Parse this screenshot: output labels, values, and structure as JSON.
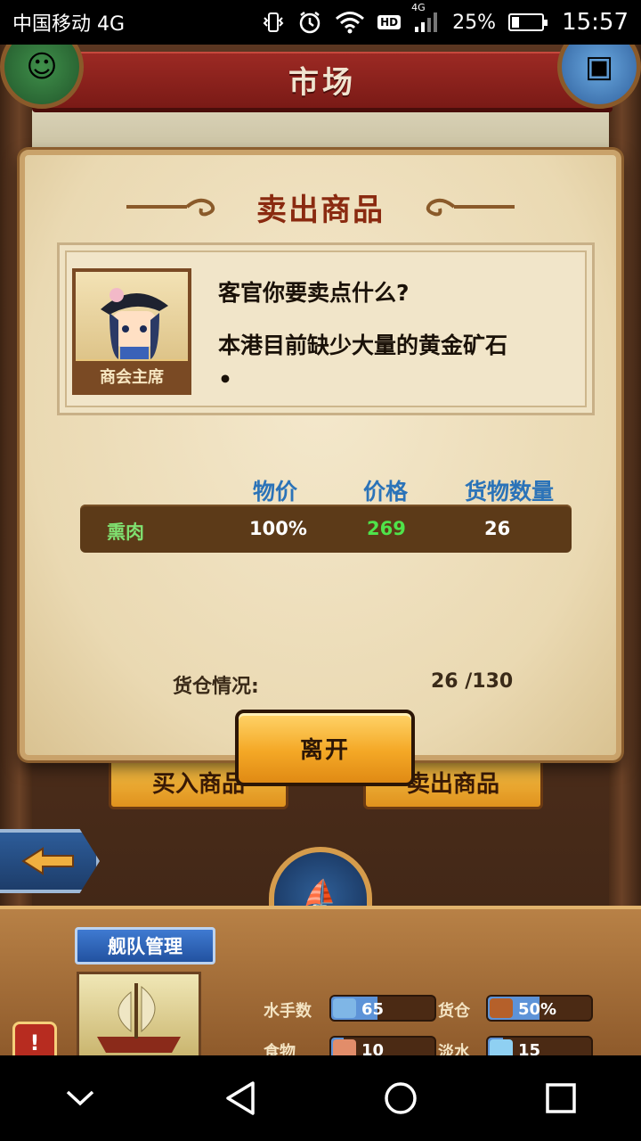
{
  "status_bar": {
    "carrier": "中国移动 4G",
    "network_label": "4G",
    "hd_label": "HD",
    "battery_percent_text": "25%",
    "battery_level": 0.25,
    "time": "15:57"
  },
  "header": {
    "title": "市场"
  },
  "dialog": {
    "title": "卖出商品",
    "npc": {
      "role_label": "商会主席",
      "line1": "客官你要卖点什么?",
      "line2": "本港目前缺少大量的黄金矿石",
      "line2_tail": "•"
    },
    "columns": {
      "price_index": "物价",
      "price": "价格",
      "quantity": "货物数量"
    },
    "goods": [
      {
        "name": "熏肉",
        "price_index": "100%",
        "price": "269",
        "quantity": "26"
      }
    ],
    "hold": {
      "label": "货仓情况:",
      "value": "26 /130"
    },
    "leave_label": "离开"
  },
  "background_buttons": {
    "buy_label": "买入商品",
    "sell_label": "卖出商品"
  },
  "fleet_panel": {
    "banner": "舰队管理",
    "alert_mark": "!",
    "stats": [
      {
        "label": "水手数",
        "value": "65",
        "icon": "sailor-icon",
        "level": 0.45
      },
      {
        "label": "货仓",
        "value": "50%",
        "icon": "crate-icon",
        "level": 0.5
      },
      {
        "label": "食物",
        "value": "10",
        "icon": "meat-icon",
        "level": 0.12
      },
      {
        "label": "淡水",
        "value": "15",
        "icon": "water-icon",
        "level": 0.15
      }
    ]
  },
  "colors": {
    "header_red": "#8e2420",
    "title_brown": "#8a2a10",
    "column_blue": "#2b73b8",
    "goods_green": "#4fe34a",
    "button_orange": "#f4a826"
  }
}
